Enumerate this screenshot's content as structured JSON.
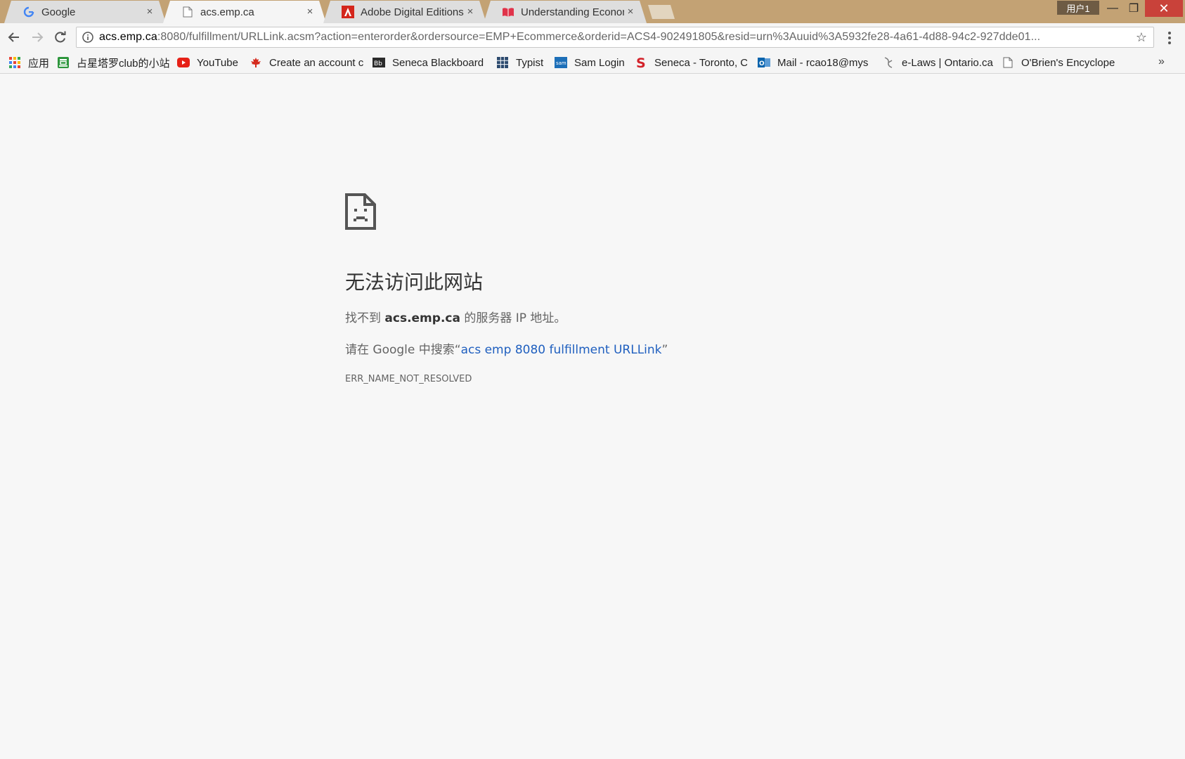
{
  "tabs": [
    {
      "title": "Google",
      "icon": "google-icon",
      "close": "×"
    },
    {
      "title": "acs.emp.ca",
      "icon": "page-icon",
      "close": "×",
      "active": true
    },
    {
      "title": "Adobe Digital Editions",
      "icon": "adobe-icon",
      "close": "×"
    },
    {
      "title": "Understanding Econon",
      "icon": "book-icon",
      "close": "×"
    }
  ],
  "window": {
    "user_label": "用户1",
    "minimize": "—",
    "maximize": "❐",
    "close": "✕"
  },
  "toolbar": {
    "url_host": "acs.emp.ca",
    "url_rest": ":8080/fulfillment/URLLink.acsm?action=enterorder&ordersource=EMP+Ecommerce&orderid=ACS4-902491805&resid=urn%3Auuid%3A5932fe28-4a61-4d88-94c2-927dde01...",
    "star": "☆"
  },
  "bookmarks": [
    {
      "label": "应用",
      "icon": "apps-grid-icon"
    },
    {
      "label": "占星塔罗club的小站",
      "icon": "douban-icon"
    },
    {
      "label": "YouTube",
      "icon": "youtube-icon"
    },
    {
      "label": "Create an account c",
      "icon": "maple-leaf-icon"
    },
    {
      "label": "Seneca Blackboard",
      "icon": "blackboard-icon"
    },
    {
      "label": "Typist",
      "icon": "typist-icon"
    },
    {
      "label": "Sam Login",
      "icon": "sam-icon"
    },
    {
      "label": "Seneca - Toronto, C",
      "icon": "seneca-s-icon"
    },
    {
      "label": "Mail - rcao18@mys",
      "icon": "outlook-icon"
    },
    {
      "label": "e-Laws | Ontario.ca",
      "icon": "elaws-icon"
    },
    {
      "label": "O'Brien's Encyclope",
      "icon": "page-icon"
    }
  ],
  "bookmarks_more": "»",
  "error": {
    "heading": "无法访问此网站",
    "line1_prefix": "找不到 ",
    "line1_host": "acs.emp.ca",
    "line1_suffix": " 的服务器 IP 地址。",
    "line2_prefix": "请在 Google 中搜索“",
    "line2_link": "acs emp 8080 fulfillment URLLink",
    "line2_suffix": "”",
    "code": "ERR_NAME_NOT_RESOLVED"
  },
  "colors": {
    "frame": "#c3a274",
    "active_tab": "#f5f5f5",
    "page_bg": "#f7f7f7",
    "link": "#1f5fbf",
    "close_button": "#c9423a"
  }
}
